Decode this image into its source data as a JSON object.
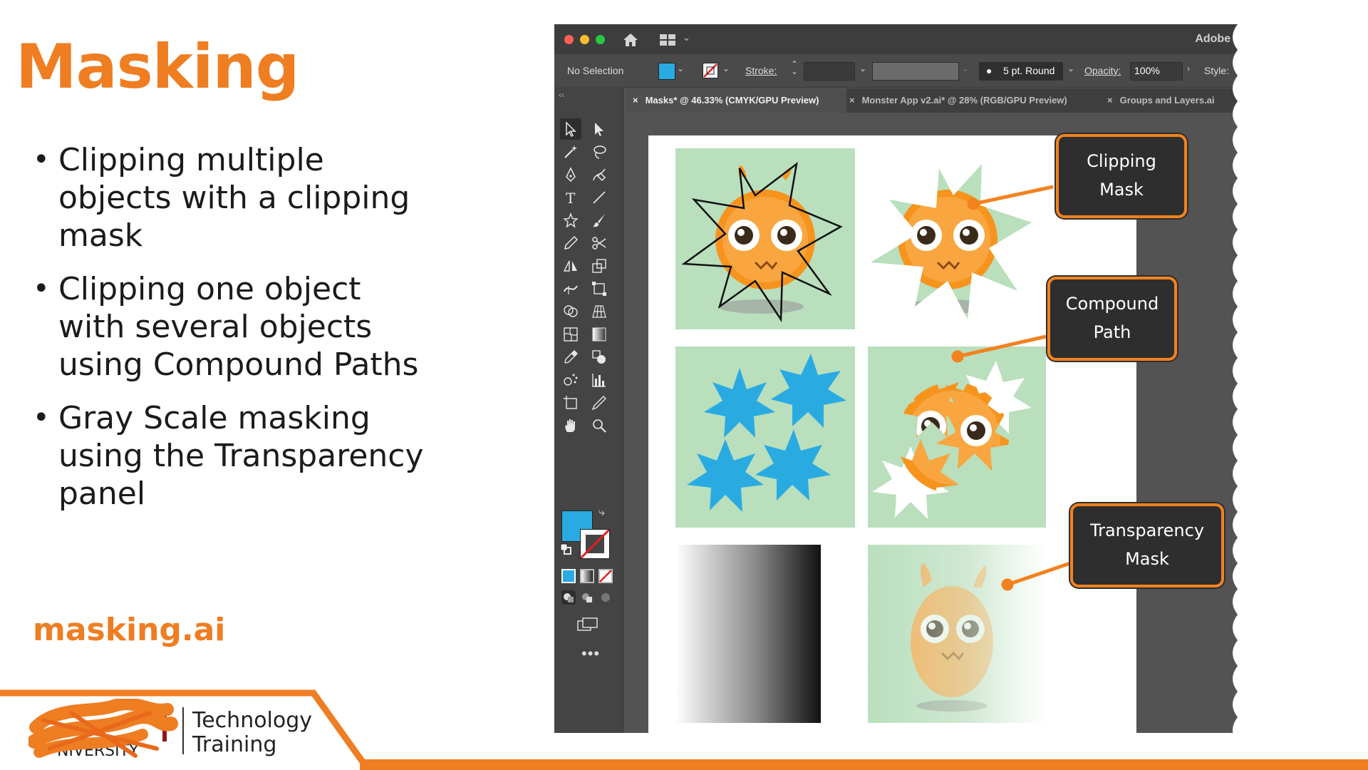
{
  "slide": {
    "title": "Masking",
    "bullets": [
      "Clipping multiple objects with a clipping mask",
      "Clipping one object with several objects using Compound Paths",
      "Gray Scale masking using the Transparency panel"
    ],
    "file_link": "masking.ai",
    "footer": {
      "logo_line1": "Technology",
      "logo_line2": "Training"
    }
  },
  "colors": {
    "accent_orange": "#ef7d22",
    "fill_blue": "#29abe2",
    "panel_green": "#b9dfbd",
    "callout_bg": "#2e2e2e"
  },
  "app": {
    "name": "Adobe I",
    "control_bar": {
      "selection": "No Selection",
      "stroke_label": "Stroke:",
      "brush": "5 pt. Round",
      "opacity_label": "Opacity:",
      "opacity_value": "100%",
      "style_label": "Style:"
    },
    "tabs": [
      {
        "label": "Masks* @ 46.33% (CMYK/GPU Preview)",
        "active": true
      },
      {
        "label": "Monster App v2.ai* @ 28% (RGB/GPU Preview)",
        "active": false
      },
      {
        "label": "Groups and Layers.ai",
        "active": false
      }
    ],
    "tab_close": "×",
    "more_tools": "•••",
    "callouts": [
      {
        "line1": "Clipping",
        "line2": "Mask"
      },
      {
        "line1": "Compound",
        "line2": "Path"
      },
      {
        "line1": "Transparency",
        "line2": "Mask"
      }
    ]
  }
}
